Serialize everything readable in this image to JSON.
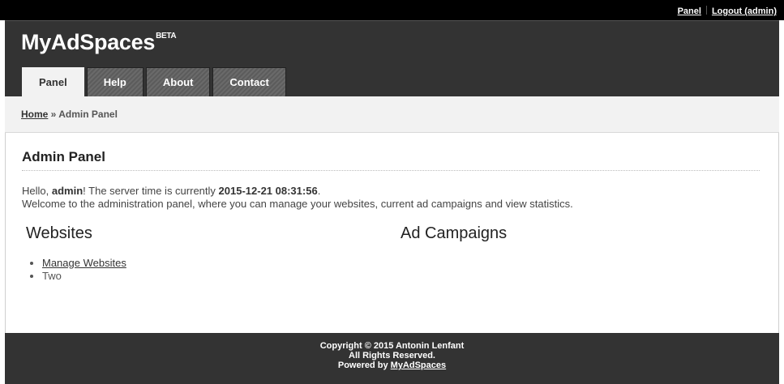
{
  "topbar": {
    "panel_link": "Panel",
    "logout_link": "Logout (admin)"
  },
  "header": {
    "brand": "MyAdSpaces",
    "badge": "BETA"
  },
  "tabs": [
    {
      "label": "Panel",
      "active": true
    },
    {
      "label": "Help",
      "active": false
    },
    {
      "label": "About",
      "active": false
    },
    {
      "label": "Contact",
      "active": false
    }
  ],
  "breadcrumb": {
    "home": "Home",
    "separator": " » ",
    "current": "Admin Panel"
  },
  "main": {
    "title": "Admin Panel",
    "greeting_prefix": "Hello, ",
    "username": "admin",
    "greeting_mid": "! The server time is currently ",
    "server_time": "2015-12-21 08:31:56",
    "greeting_suffix": ".",
    "welcome": "Welcome to the administration panel, where you can manage your websites, current ad campaigns and view statistics.",
    "websites_title": "Websites",
    "websites_items": [
      "Manage Websites",
      "Two"
    ],
    "campaigns_title": "Ad Campaigns"
  },
  "footer": {
    "copyright": "Copyright © 2015 Antonin Lenfant",
    "rights": "All Rights Reserved.",
    "powered_prefix": "Powered by ",
    "powered_link": "MyAdSpaces"
  }
}
